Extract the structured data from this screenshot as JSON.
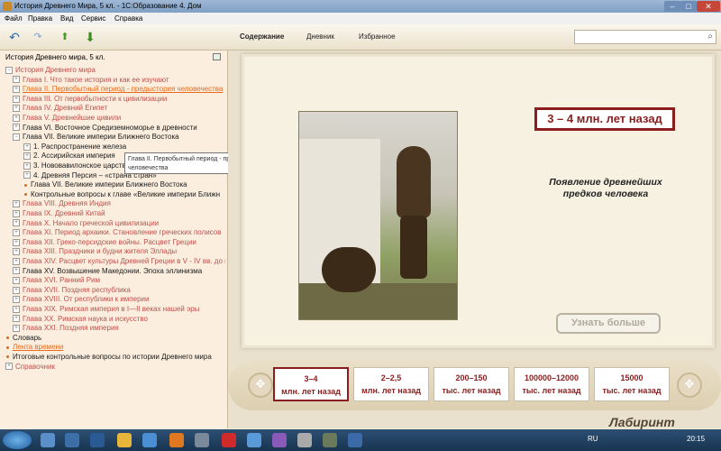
{
  "window": {
    "title": "История Древнего Мира, 5 кл. - 1С:Образование 4. Дом"
  },
  "menu": [
    "Файл",
    "Правка",
    "Вид",
    "Сервис",
    "Справка"
  ],
  "toolbar": {
    "tabs": [
      {
        "label": "Содержание",
        "active": true
      },
      {
        "label": "Дневник",
        "active": false
      },
      {
        "label": "Избранное",
        "active": false
      }
    ],
    "search_placeholder": ""
  },
  "sidebar": {
    "header": "История Древнего мира, 5 кл.",
    "items": [
      {
        "label": "История Древнего мира",
        "icon": "minus"
      },
      {
        "label": "Глава I. Что такое история и как ее изучают",
        "icon": "plus"
      },
      {
        "label": "Глава II. Первобытный период - предыстория человечества",
        "icon": "plus"
      },
      {
        "label": "Глава III. От первобытности к цивилизации",
        "icon": "plus"
      },
      {
        "label": "Глава IV. Древний Египет",
        "icon": "plus"
      },
      {
        "label": "Глава V. Древнейшие цивили",
        "icon": "plus"
      },
      {
        "label": "Глава VI. Восточное Средиземноморье в древности",
        "icon": "plus"
      },
      {
        "label": "Глава VII. Великие империи Ближнего Востока",
        "icon": "minus"
      },
      {
        "label": "1. Распространение железа",
        "icon": "plus"
      },
      {
        "label": "2. Ассирийская империя",
        "icon": "plus"
      },
      {
        "label": "3. Нововавилонское царство",
        "icon": "plus"
      },
      {
        "label": "4. Древняя Персия – «страна стран»",
        "icon": "plus"
      },
      {
        "label": "Глава VII. Великие империи Ближнего Востока",
        "icon": "bullet"
      },
      {
        "label": "Контрольные вопросы к главе «Великие империи Ближн",
        "icon": "bullet"
      },
      {
        "label": "Глава VIII. Древняя Индия",
        "icon": "plus"
      },
      {
        "label": "Глава IX. Древний Китай",
        "icon": "plus"
      },
      {
        "label": "Глава X. Начало греческой цивилизации",
        "icon": "plus"
      },
      {
        "label": "Глава XI. Период архаики. Становление греческих полисов",
        "icon": "plus"
      },
      {
        "label": "Глава XII. Греко-персидские войны. Расцвет Греции",
        "icon": "plus"
      },
      {
        "label": "Глава XIII. Праздники и будни жителя Эллады",
        "icon": "plus"
      },
      {
        "label": "Глава XIV. Расцвет культуры Древней Греции в V - IV вв. до н",
        "icon": "plus"
      },
      {
        "label": "Глава XV. Возвышение Македонии. Эпоха эллинизма",
        "icon": "plus"
      },
      {
        "label": "Глава XVI. Ранний Рим",
        "icon": "plus"
      },
      {
        "label": "Глава XVII. Поздняя республика",
        "icon": "plus"
      },
      {
        "label": "Глава XVIII. От республики к империи",
        "icon": "plus"
      },
      {
        "label": "Глава XIX. Римская империя в I—II веках нашей эры",
        "icon": "plus"
      },
      {
        "label": "Глава XX. Римская наука и искусство",
        "icon": "plus"
      },
      {
        "label": "Глава XXI. Поздняя империя",
        "icon": "plus"
      },
      {
        "label": "Словарь",
        "icon": "bullet"
      },
      {
        "label": "Лента времени",
        "icon": "bullet"
      },
      {
        "label": "Итоговые контрольные вопросы по истории Древнего мира",
        "icon": "bullet"
      },
      {
        "label": "Справочник",
        "icon": "plus"
      }
    ],
    "tooltip": "Глава II. Первобытный период - предыстория человечества"
  },
  "content": {
    "time_label": "3 – 4 млн. лет назад",
    "topic_title": "Появление древнейших предков человека",
    "more_button": "Узнать больше"
  },
  "periods": [
    {
      "top": "3–4",
      "bottom": "млн. лет назад",
      "selected": true
    },
    {
      "top": "2–2,5",
      "bottom": "млн. лет назад",
      "selected": false
    },
    {
      "top": "200–150",
      "bottom": "тыс. лет назад",
      "selected": false
    },
    {
      "top": "100000–12000",
      "bottom": "тыс. лет назад",
      "selected": false
    },
    {
      "top": "15000",
      "bottom": "тыс. лет назад",
      "selected": false
    }
  ],
  "taskbar": {
    "lang": "RU",
    "clock": "20:15"
  },
  "watermark": "Лабиринт"
}
